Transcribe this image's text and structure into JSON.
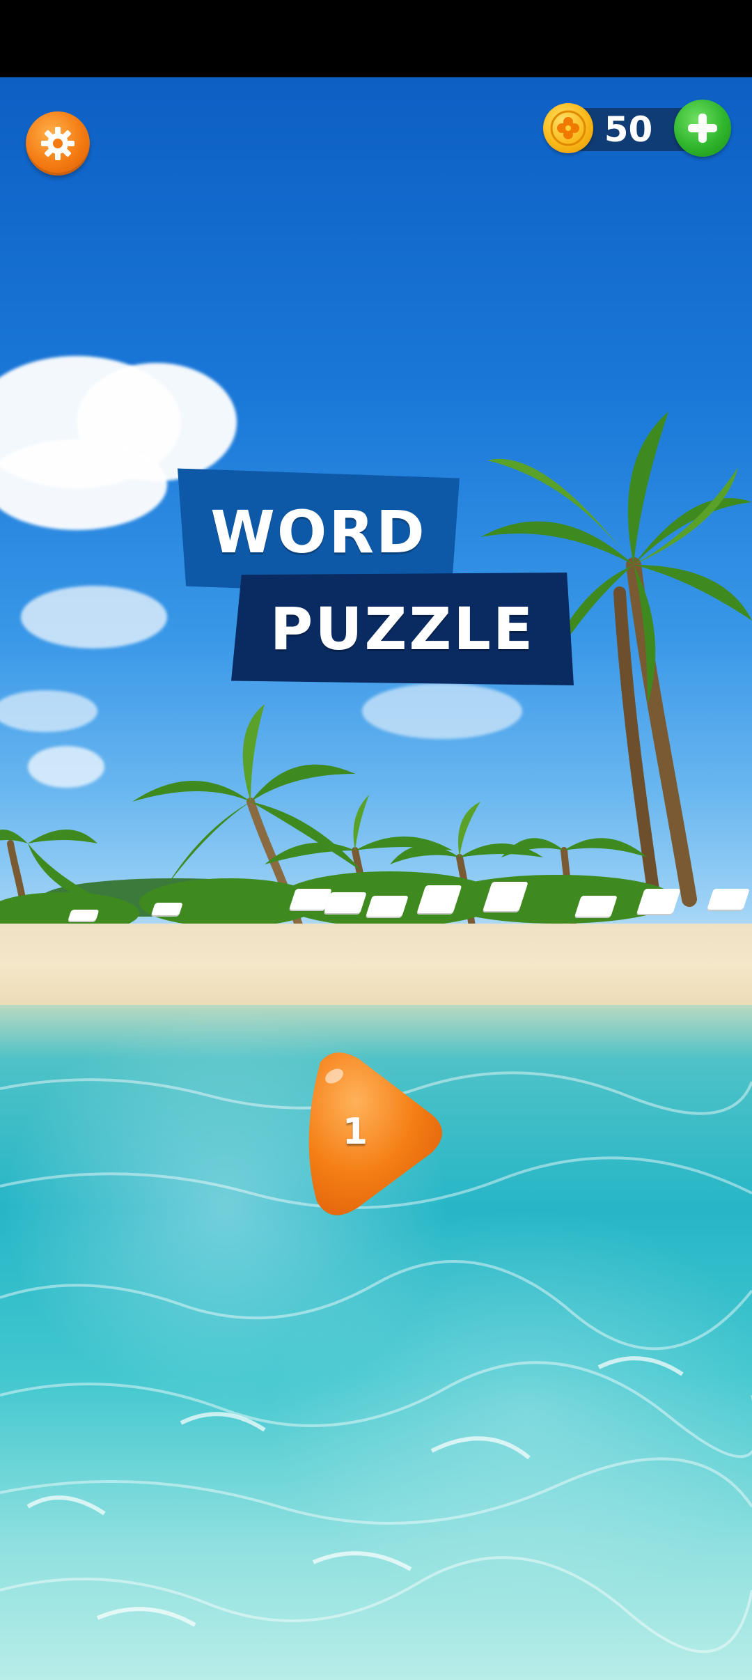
{
  "topbar": {
    "settings_icon": "gear-icon",
    "coins": "50",
    "coin_icon": "clover-coin-icon",
    "add_icon": "plus-icon"
  },
  "title": {
    "line1": "WORD",
    "line2": "PUZZLE"
  },
  "level": {
    "number": "1"
  },
  "colors": {
    "settings": "#f47a12",
    "coin": "#f9b818",
    "coin_bar": "#0f3c74",
    "add_button": "#2fb52c",
    "title_word_banner": "#0e59a7",
    "title_puzzle_banner": "#0a2b62",
    "level_button": "#f57f16"
  }
}
